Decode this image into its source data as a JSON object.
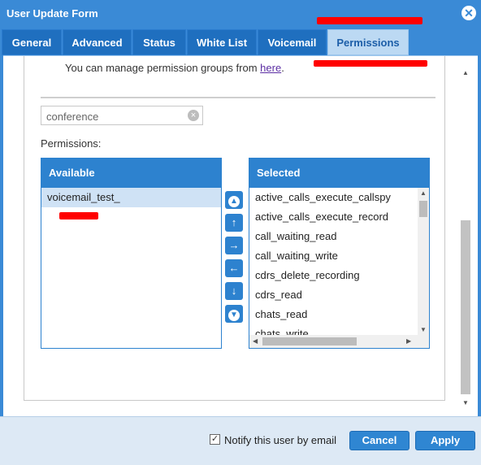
{
  "window": {
    "title": "User Update Form"
  },
  "tabs": [
    {
      "label": "General"
    },
    {
      "label": "Advanced"
    },
    {
      "label": "Status"
    },
    {
      "label": "White List"
    },
    {
      "label": "Voicemail"
    },
    {
      "label": "Permissions",
      "active": true
    }
  ],
  "permissions": {
    "info_text": "You can manage permission groups from ",
    "info_link": "here",
    "info_suffix": ".",
    "search": {
      "value": "conference"
    },
    "label": "Permissions:",
    "available": {
      "header": "Available",
      "items": [
        {
          "label": "voicemail_test_"
        }
      ]
    },
    "selected": {
      "header": "Selected",
      "items": [
        {
          "label": "active_calls_execute_callspy"
        },
        {
          "label": "active_calls_execute_record"
        },
        {
          "label": "call_waiting_read"
        },
        {
          "label": "call_waiting_write"
        },
        {
          "label": "cdrs_delete_recording"
        },
        {
          "label": "cdrs_read"
        },
        {
          "label": "chats_read"
        },
        {
          "label": "chats_write"
        }
      ]
    }
  },
  "footer": {
    "notify_label": "Notify this user by email",
    "notify_checked": true,
    "cancel_label": "Cancel",
    "apply_label": "Apply"
  },
  "colors": {
    "accent": "#3a8ad6",
    "list_header": "#2d82cf",
    "redaction": "#ff0000"
  }
}
